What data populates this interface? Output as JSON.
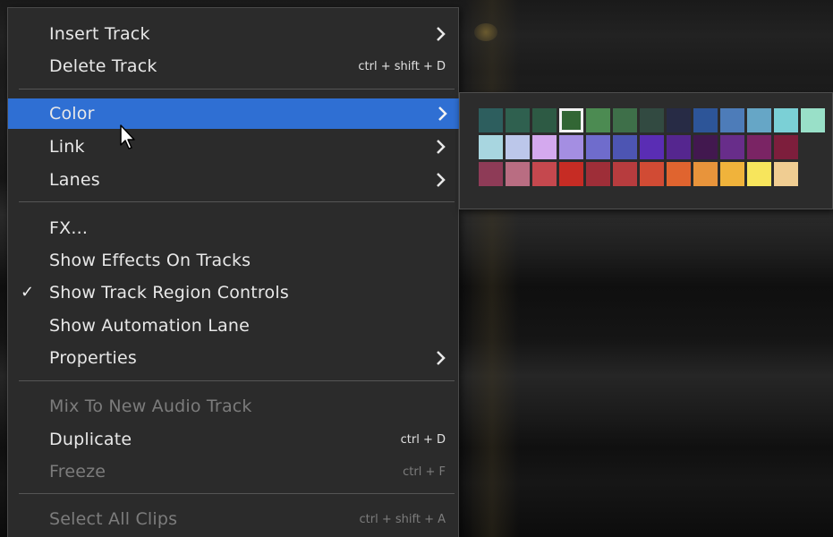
{
  "menu": {
    "items": [
      {
        "label": "Insert Track",
        "shortcut": "",
        "submenu": true,
        "checked": false,
        "disabled": false,
        "highlight": false
      },
      {
        "label": "Delete Track",
        "shortcut": "ctrl + shift + D",
        "submenu": false,
        "checked": false,
        "disabled": false,
        "highlight": false
      },
      {
        "label": "Color",
        "shortcut": "",
        "submenu": true,
        "checked": false,
        "disabled": false,
        "highlight": true
      },
      {
        "label": "Link",
        "shortcut": "",
        "submenu": true,
        "checked": false,
        "disabled": false,
        "highlight": false
      },
      {
        "label": "Lanes",
        "shortcut": "",
        "submenu": true,
        "checked": false,
        "disabled": false,
        "highlight": false
      },
      {
        "label": "FX...",
        "shortcut": "",
        "submenu": false,
        "checked": false,
        "disabled": false,
        "highlight": false
      },
      {
        "label": "Show Effects On Tracks",
        "shortcut": "",
        "submenu": false,
        "checked": false,
        "disabled": false,
        "highlight": false
      },
      {
        "label": "Show Track Region Controls",
        "shortcut": "",
        "submenu": false,
        "checked": true,
        "disabled": false,
        "highlight": false
      },
      {
        "label": "Show Automation Lane",
        "shortcut": "",
        "submenu": false,
        "checked": false,
        "disabled": false,
        "highlight": false
      },
      {
        "label": "Properties",
        "shortcut": "",
        "submenu": true,
        "checked": false,
        "disabled": false,
        "highlight": false
      },
      {
        "label": "Mix To New Audio Track",
        "shortcut": "",
        "submenu": false,
        "checked": false,
        "disabled": true,
        "highlight": false
      },
      {
        "label": "Duplicate",
        "shortcut": "ctrl + D",
        "submenu": false,
        "checked": false,
        "disabled": false,
        "highlight": false
      },
      {
        "label": "Freeze",
        "shortcut": "ctrl + F",
        "submenu": false,
        "checked": false,
        "disabled": true,
        "highlight": false
      },
      {
        "label": "Select All Clips",
        "shortcut": "ctrl + shift + A",
        "submenu": false,
        "checked": false,
        "disabled": true,
        "highlight": false
      }
    ],
    "check_glyph": "✓"
  },
  "color_palette": {
    "rows": [
      [
        "#2d5e5e",
        "#2f604f",
        "#2d5a44",
        "#326634",
        "#4c8b52",
        "#3e6f49",
        "#324a41",
        "#272b45",
        "#2d5598",
        "#4d7cb9",
        "#66a6c6",
        "#7bd0d6",
        "#99e0c8"
      ],
      [
        "#a8d6e0",
        "#bcc7ea",
        "#d4a9ee",
        "#a48ee2",
        "#6f6ccc",
        "#4d55b3",
        "#5a2db4",
        "#55268f",
        "#42184f",
        "#682d8a",
        "#7a2464",
        "#7d1e3c"
      ],
      [
        "#8e3b57",
        "#b96d82",
        "#c5484e",
        "#c62c24",
        "#9e2e38",
        "#b73c3e",
        "#d14b34",
        "#e0642f",
        "#e8943b",
        "#f0b33b",
        "#f7e55c",
        "#f0cd92"
      ]
    ],
    "selected_row": 0,
    "selected_index": 3
  }
}
